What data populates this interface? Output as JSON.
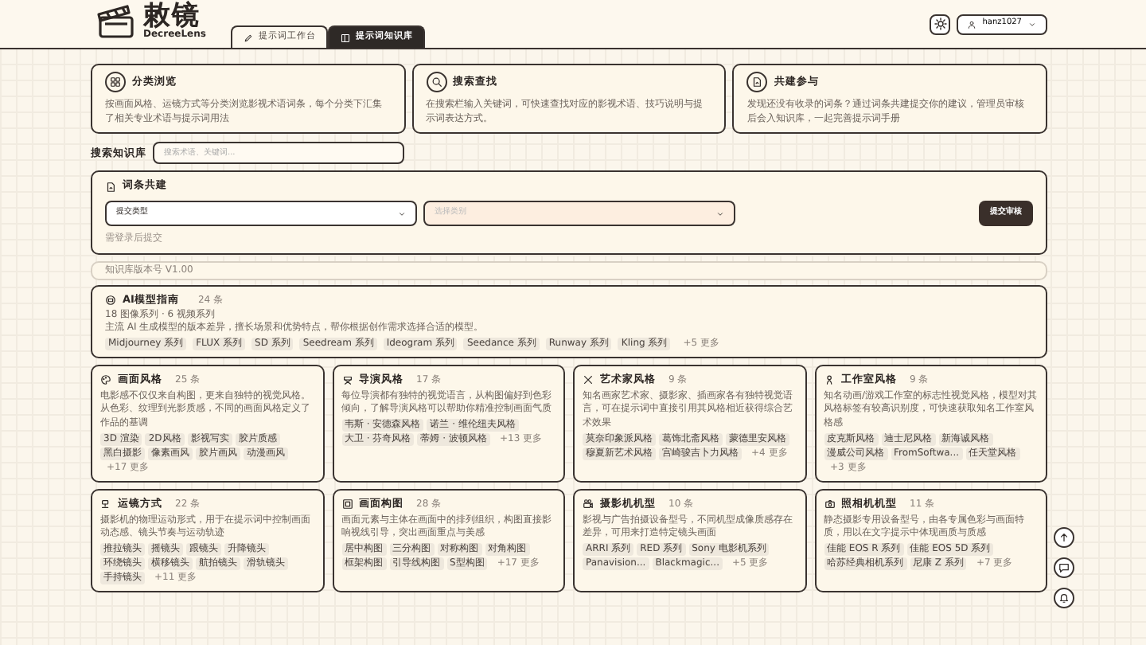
{
  "header": {
    "logo_title": "敕镜",
    "logo_subtitle": "DecreeLens",
    "tabs": [
      {
        "label": "提示词工作台",
        "selected": false
      },
      {
        "label": "提示词知识库",
        "selected": true
      }
    ],
    "user": "hanz1027"
  },
  "intro_cards": [
    {
      "title": "分类浏览",
      "text": "按画面风格、运镜方式等分类浏览影视术语词条，每个分类下汇集了相关专业术语与提示词用法"
    },
    {
      "title": "搜索查找",
      "text": "在搜索栏输入关键词，可快速查找对应的影视术语、技巧说明与提示词表达方式。"
    },
    {
      "title": "共建参与",
      "text": "发现还没有收录的词条？通过词条共建提交你的建议，管理员审核后会入知识库，一起完善提示词手册"
    }
  ],
  "search": {
    "label": "搜索知识库",
    "placeholder": "搜索术语、关键词..."
  },
  "submit_panel": {
    "title": "词条共建",
    "type_select": "提交类型",
    "category_select": {
      "placeholder": "选择类别",
      "disabled": true
    },
    "button": "提交审核",
    "note": "需登录后提交"
  },
  "version": "知识库版本号 V1.00",
  "featured": {
    "title": "AI模型指南",
    "count": "24 条",
    "subtitle": "18 图像系列 · 6 视频系列",
    "description": "主流 AI 生成模型的版本差异，擅长场景和优势特点，帮你根据创作需求选择合适的模型。",
    "tags": [
      "Midjourney 系列",
      "FLUX 系列",
      "SD 系列",
      "Seedream 系列",
      "Ideogram 系列",
      "Seedance 系列",
      "Runway 系列",
      "Kling 系列"
    ],
    "more": "+5 更多"
  },
  "categories": [
    {
      "title": "画面风格",
      "count": "25 条",
      "description": "电影感不仅仅来自构图，更来自独特的视觉风格。从色彩、纹理到光影质感，不同的画面风格定义了作品的基调",
      "tags": [
        "3D 渲染",
        "2D风格",
        "影视写实",
        "胶片质感",
        "黑白摄影",
        "像素画风",
        "胶片画风",
        "动漫画风"
      ],
      "more": "+17 更多"
    },
    {
      "title": "导演风格",
      "count": "17 条",
      "description": "每位导演都有独特的视觉语言，从构图偏好到色彩倾向，了解导演风格可以帮助你精准控制画面气质",
      "tags": [
        "韦斯 · 安德森风格",
        "诺兰 · 维伦纽夫风格",
        "大卫 · 芬奇风格",
        "蒂姆 · 波顿风格"
      ],
      "more": "+13 更多"
    },
    {
      "title": "艺术家风格",
      "count": "9 条",
      "description": "知名画家艺术家、摄影家、插画家各有独特视觉语言，可在提示词中直接引用其风格相近获得综合艺术效果",
      "tags": [
        "莫奈印象派风格",
        "葛饰北斋风格",
        "蒙德里安风格",
        "穆夏新艺术风格",
        "宫崎骏吉卜力风格"
      ],
      "more": "+4 更多"
    },
    {
      "title": "工作室风格",
      "count": "9 条",
      "description": "知名动画/游戏工作室的标志性视觉风格，模型对其风格标签有较高识别度，可快速获取知名工作室风格感",
      "tags": [
        "皮克斯风格",
        "迪士尼风格",
        "新海诚风格",
        "漫威公司风格",
        "FromSoftwa...",
        "任天堂风格"
      ],
      "more": "+3 更多"
    },
    {
      "title": "运镜方式",
      "count": "22 条",
      "description": "摄影机的物理运动形式，用于在提示词中控制画面动态感、镜头节奏与运动轨迹",
      "tags": [
        "推拉镜头",
        "摇镜头",
        "跟镜头",
        "升降镜头",
        "环绕镜头",
        "横移镜头",
        "航拍镜头",
        "滑轨镜头",
        "手持镜头"
      ],
      "more": "+11 更多"
    },
    {
      "title": "画面构图",
      "count": "28 条",
      "description": "画面元素与主体在画面中的排列组织，构图直接影响视线引导，突出画面重点与美感",
      "tags": [
        "居中构图",
        "三分构图",
        "对称构图",
        "对角构图",
        "框架构图",
        "引导线构图",
        "S型构图"
      ],
      "more": "+17 更多"
    },
    {
      "title": "摄影机机型",
      "count": "10 条",
      "description": "影视与广告拍摄设备型号，不同机型成像质感存在差异，可用来打造特定镜头画面",
      "tags": [
        "ARRI 系列",
        "RED 系列",
        "Sony 电影机系列",
        "Panavision...",
        "Blackmagic..."
      ],
      "more": "+5 更多"
    },
    {
      "title": "照相机机型",
      "count": "11 条",
      "description": "静态摄影专用设备型号，由各专属色彩与画面特质，用以在文字提示中体现画质与质感",
      "tags": [
        "佳能 EOS R 系列",
        "佳能 EOS 5D 系列",
        "哈苏经典相机系列",
        "尼康 Z 系列"
      ],
      "more": "+7 更多"
    }
  ],
  "float_buttons": [
    {
      "kind": "up"
    },
    {
      "kind": "chat"
    },
    {
      "kind": "bell"
    }
  ]
}
